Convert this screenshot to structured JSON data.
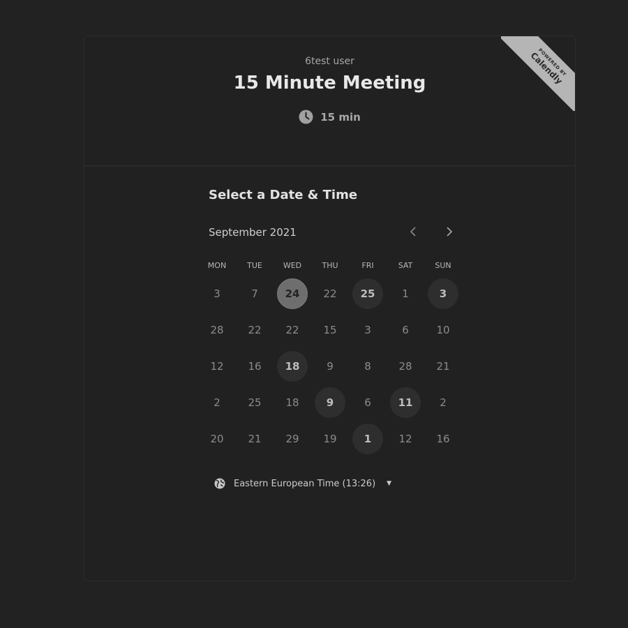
{
  "header": {
    "owner_name": "6test user",
    "event_title": "15 Minute Meeting",
    "duration": "15 min",
    "duration_icon": "clock-icon"
  },
  "badge": {
    "small_text": "POWERED BY",
    "brand": "Calendly"
  },
  "picker": {
    "title": "Select a Date & Time",
    "month_label": "September 2021",
    "prev_icon": "chevron-left-icon",
    "next_icon": "chevron-right-icon",
    "weekdays": [
      "MON",
      "TUE",
      "WED",
      "THU",
      "FRI",
      "SAT",
      "SUN"
    ],
    "days": [
      {
        "label": "3",
        "state": "default"
      },
      {
        "label": "7",
        "state": "default"
      },
      {
        "label": "24",
        "state": "selected"
      },
      {
        "label": "22",
        "state": "default"
      },
      {
        "label": "25",
        "state": "available"
      },
      {
        "label": "1",
        "state": "default"
      },
      {
        "label": "3",
        "state": "available"
      },
      {
        "label": "28",
        "state": "default"
      },
      {
        "label": "22",
        "state": "default"
      },
      {
        "label": "22",
        "state": "default"
      },
      {
        "label": "15",
        "state": "default"
      },
      {
        "label": "3",
        "state": "default"
      },
      {
        "label": "6",
        "state": "default"
      },
      {
        "label": "10",
        "state": "default"
      },
      {
        "label": "12",
        "state": "default"
      },
      {
        "label": "16",
        "state": "default"
      },
      {
        "label": "18",
        "state": "available"
      },
      {
        "label": "9",
        "state": "default"
      },
      {
        "label": "8",
        "state": "default"
      },
      {
        "label": "28",
        "state": "default"
      },
      {
        "label": "21",
        "state": "default"
      },
      {
        "label": "2",
        "state": "default"
      },
      {
        "label": "25",
        "state": "default"
      },
      {
        "label": "18",
        "state": "default"
      },
      {
        "label": "9",
        "state": "available"
      },
      {
        "label": "6",
        "state": "default"
      },
      {
        "label": "11",
        "state": "available"
      },
      {
        "label": "2",
        "state": "default"
      },
      {
        "label": "20",
        "state": "default"
      },
      {
        "label": "21",
        "state": "default"
      },
      {
        "label": "29",
        "state": "default"
      },
      {
        "label": "19",
        "state": "default"
      },
      {
        "label": "1",
        "state": "available"
      },
      {
        "label": "12",
        "state": "default"
      },
      {
        "label": "16",
        "state": "default"
      }
    ]
  },
  "timezone": {
    "label": "Eastern European Time (13:26)",
    "icon": "globe-icon",
    "dropdown_icon": "caret-down-icon"
  },
  "colors": {
    "page_background": "#222222",
    "card_background": "#212121",
    "selected_day": "#6e6e6e",
    "available_day": "#2e2e2e",
    "badge": "#b5b5b5"
  }
}
